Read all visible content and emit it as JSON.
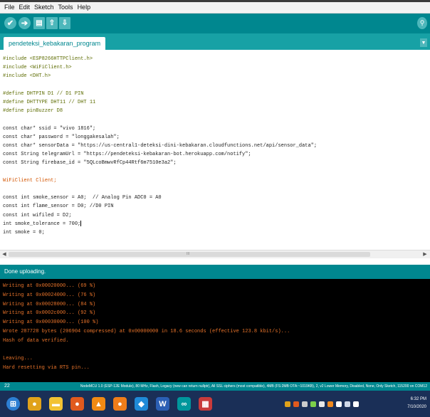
{
  "menu": [
    "File",
    "Edit",
    "Sketch",
    "Tools",
    "Help"
  ],
  "toolbar": {
    "verify_glyph": "✔",
    "upload_glyph": "➔",
    "new_glyph": "▤",
    "open_glyph": "⇧",
    "save_glyph": "⇩",
    "serial_glyph": "⚲",
    "accent": "#00878f"
  },
  "tab": {
    "name": "pendeteksi_kebakaran_program",
    "menu_glyph": "▼"
  },
  "code": [
    {
      "text": "#include <ESP8266HTTPClient.h>",
      "color": "#5e6d03"
    },
    {
      "text": "#include <WiFiClient.h>",
      "color": "#5e6d03"
    },
    {
      "text": "#include <DHT.h>",
      "color": "#5e6d03"
    },
    {
      "text": "",
      "color": "#222222"
    },
    {
      "text": "#define DHTPIN D1 // D1 PIN",
      "color": "#5e6d03"
    },
    {
      "text": "#define DHTTYPE DHT11 // DHT 11",
      "color": "#5e6d03"
    },
    {
      "text": "#define pinBuzzer D8",
      "color": "#5e6d03"
    },
    {
      "text": "",
      "color": "#222222"
    },
    {
      "text": "const char* ssid = \"vivo 1816\";",
      "color": "#222222"
    },
    {
      "text": "const char* password = \"longgakesalah\";",
      "color": "#222222"
    },
    {
      "text": "const char* sensorData = \"https://us-central1-deteksi-dini-kebakaran.cloudfunctions.net/api/sensor_data\";",
      "color": "#222222"
    },
    {
      "text": "const String telegramUrl = \"https://pendeteksi-kebakaran-bot.herokuapp.com/notify\";",
      "color": "#222222"
    },
    {
      "text": "const String firebase_id = \"5QLcoBmwvRfCp44Rtf6m7510e3a2\";",
      "color": "#222222"
    },
    {
      "text": "",
      "color": "#222222"
    },
    {
      "text": "WiFiClient Client;",
      "color": "#d35400"
    },
    {
      "text": "",
      "color": "#222222"
    },
    {
      "text": "const int smoke_sensor = A0;  // Analog Pin ADC0 = A0",
      "color": "#222222"
    },
    {
      "text": "const int flame_sensor = D0; //D0 PIN",
      "color": "#222222"
    },
    {
      "text": "const int wifiled = D2;",
      "color": "#222222"
    },
    {
      "text": "int smoke_tolerance = 700;",
      "color": "#222222"
    },
    {
      "text": "int smoke = 0;",
      "color": "#222222"
    }
  ],
  "scrollbar": {
    "left_arrow": "◀",
    "right_arrow": "▶",
    "grip": "III"
  },
  "status": {
    "text": "Done uploading."
  },
  "console": [
    {
      "text": "Writing at 0x00020000... (69 %)",
      "color": "#e8732a"
    },
    {
      "text": "Writing at 0x00024000... (76 %)",
      "color": "#e8732a"
    },
    {
      "text": "Writing at 0x00028000... (84 %)",
      "color": "#e8732a"
    },
    {
      "text": "Writing at 0x0002c000... (92 %)",
      "color": "#e8732a"
    },
    {
      "text": "Writing at 0x00030000... (100 %)",
      "color": "#e8732a"
    },
    {
      "text": "Wrote 287728 bytes (206904 compressed) at 0x00000000 in 18.6 seconds (effective 123.8 kbit/s)...",
      "color": "#e8732a"
    },
    {
      "text": "Hash of data verified.",
      "color": "#e8732a"
    },
    {
      "text": "",
      "color": "#e8732a"
    },
    {
      "text": "Leaving...",
      "color": "#e8732a"
    },
    {
      "text": "Hard resetting via RTS pin...",
      "color": "#e8732a"
    }
  ],
  "footer": {
    "line_number": "22",
    "board_info": "NodeMCU 1.0 (ESP-12E Module), 80 MHz, Flash, Legacy (new can return nullptr), All SSL ciphers (most compatible), 4MB (FS:2MB OTA:~1019KB), 2, v2 Lower Memory, Disabled, None, Only Sketch, 115200 on COM12"
  },
  "taskbar": {
    "apps": [
      {
        "name": "start",
        "glyph": "⊞",
        "color": "#2d7fd3"
      },
      {
        "name": "chrome",
        "glyph": "●",
        "color": "#e0a21a"
      },
      {
        "name": "file-explorer",
        "glyph": "▬",
        "color": "#f2c233"
      },
      {
        "name": "firefox",
        "glyph": "●",
        "color": "#e05a1e"
      },
      {
        "name": "vlc",
        "glyph": "▲",
        "color": "#f08a14"
      },
      {
        "name": "app-orange",
        "glyph": "●",
        "color": "#ef7d1a"
      },
      {
        "name": "app-blue",
        "glyph": "◆",
        "color": "#1f8ad8"
      },
      {
        "name": "word",
        "glyph": "W",
        "color": "#2b5fb4"
      },
      {
        "name": "arduino",
        "glyph": "∞",
        "color": "#00979c"
      },
      {
        "name": "app-grid",
        "glyph": "▦",
        "color": "#c93b3b"
      }
    ],
    "time": "6:32 PM",
    "date": "7/10/2020"
  }
}
